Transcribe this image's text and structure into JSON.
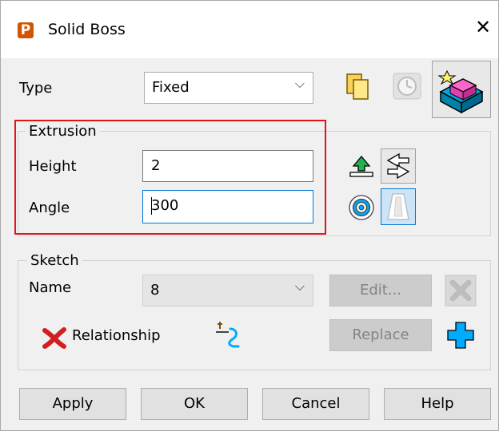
{
  "window": {
    "title": "Solid Boss",
    "app_icon_letter": "P",
    "close_glyph": "✕"
  },
  "type": {
    "label": "Type",
    "value": "Fixed"
  },
  "extrusion": {
    "group_label": "Extrusion",
    "height_label": "Height",
    "height_value": "2",
    "angle_label": "Angle",
    "angle_value": "300"
  },
  "sketch": {
    "group_label": "Sketch",
    "name_label": "Name",
    "name_value": "8",
    "edit_label": "Edit...",
    "relationship_label": "Relationship",
    "replace_label": "Replace"
  },
  "buttons": {
    "apply": "Apply",
    "ok": "OK",
    "cancel": "Cancel",
    "help": "Help"
  },
  "colors": {
    "highlight": "#e0131e",
    "focus": "#0078d7",
    "accent": "#00aaff"
  }
}
